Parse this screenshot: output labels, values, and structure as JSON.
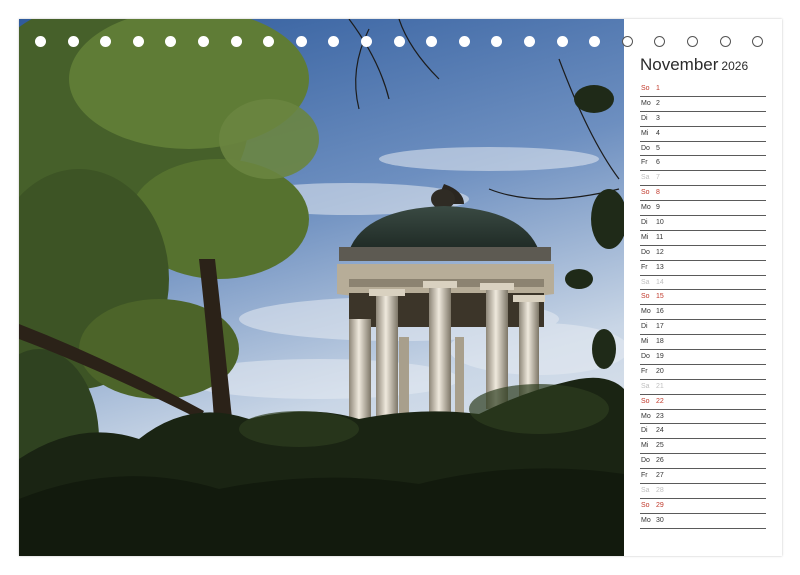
{
  "calendar": {
    "month": "November",
    "year": "2026",
    "days": [
      {
        "wd": "So",
        "num": "1",
        "type": "sun"
      },
      {
        "wd": "Mo",
        "num": "2",
        "type": "week"
      },
      {
        "wd": "Di",
        "num": "3",
        "type": "week"
      },
      {
        "wd": "Mi",
        "num": "4",
        "type": "week"
      },
      {
        "wd": "Do",
        "num": "5",
        "type": "week"
      },
      {
        "wd": "Fr",
        "num": "6",
        "type": "week"
      },
      {
        "wd": "Sa",
        "num": "7",
        "type": "sat"
      },
      {
        "wd": "So",
        "num": "8",
        "type": "sun"
      },
      {
        "wd": "Mo",
        "num": "9",
        "type": "week"
      },
      {
        "wd": "Di",
        "num": "10",
        "type": "week"
      },
      {
        "wd": "Mi",
        "num": "11",
        "type": "week"
      },
      {
        "wd": "Do",
        "num": "12",
        "type": "week"
      },
      {
        "wd": "Fr",
        "num": "13",
        "type": "week"
      },
      {
        "wd": "Sa",
        "num": "14",
        "type": "sat"
      },
      {
        "wd": "So",
        "num": "15",
        "type": "sun"
      },
      {
        "wd": "Mo",
        "num": "16",
        "type": "week"
      },
      {
        "wd": "Di",
        "num": "17",
        "type": "week"
      },
      {
        "wd": "Mi",
        "num": "18",
        "type": "week"
      },
      {
        "wd": "Do",
        "num": "19",
        "type": "week"
      },
      {
        "wd": "Fr",
        "num": "20",
        "type": "week"
      },
      {
        "wd": "Sa",
        "num": "21",
        "type": "sat"
      },
      {
        "wd": "So",
        "num": "22",
        "type": "sun"
      },
      {
        "wd": "Mo",
        "num": "23",
        "type": "week"
      },
      {
        "wd": "Di",
        "num": "24",
        "type": "week"
      },
      {
        "wd": "Mi",
        "num": "25",
        "type": "week"
      },
      {
        "wd": "Do",
        "num": "26",
        "type": "week"
      },
      {
        "wd": "Fr",
        "num": "27",
        "type": "week"
      },
      {
        "wd": "Sa",
        "num": "28",
        "type": "sat"
      },
      {
        "wd": "So",
        "num": "29",
        "type": "sun"
      },
      {
        "wd": "Mo",
        "num": "30",
        "type": "week"
      }
    ]
  },
  "binding": {
    "hole_count": 23
  },
  "colors": {
    "sunday": "#c0392b",
    "saturday": "#bfbfbf",
    "text": "#333333",
    "sky": "#4a6fa5"
  }
}
